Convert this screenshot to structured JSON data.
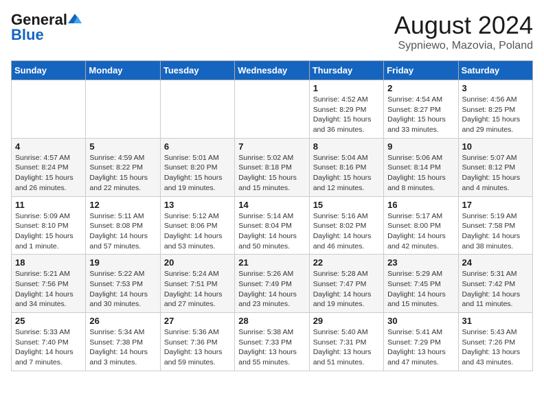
{
  "header": {
    "logo_line1": "General",
    "logo_line2": "Blue",
    "month_title": "August 2024",
    "subtitle": "Sypniewo, Mazovia, Poland"
  },
  "days_of_week": [
    "Sunday",
    "Monday",
    "Tuesday",
    "Wednesday",
    "Thursday",
    "Friday",
    "Saturday"
  ],
  "weeks": [
    [
      {
        "num": "",
        "info": ""
      },
      {
        "num": "",
        "info": ""
      },
      {
        "num": "",
        "info": ""
      },
      {
        "num": "",
        "info": ""
      },
      {
        "num": "1",
        "info": "Sunrise: 4:52 AM\nSunset: 8:29 PM\nDaylight: 15 hours\nand 36 minutes."
      },
      {
        "num": "2",
        "info": "Sunrise: 4:54 AM\nSunset: 8:27 PM\nDaylight: 15 hours\nand 33 minutes."
      },
      {
        "num": "3",
        "info": "Sunrise: 4:56 AM\nSunset: 8:25 PM\nDaylight: 15 hours\nand 29 minutes."
      }
    ],
    [
      {
        "num": "4",
        "info": "Sunrise: 4:57 AM\nSunset: 8:24 PM\nDaylight: 15 hours\nand 26 minutes."
      },
      {
        "num": "5",
        "info": "Sunrise: 4:59 AM\nSunset: 8:22 PM\nDaylight: 15 hours\nand 22 minutes."
      },
      {
        "num": "6",
        "info": "Sunrise: 5:01 AM\nSunset: 8:20 PM\nDaylight: 15 hours\nand 19 minutes."
      },
      {
        "num": "7",
        "info": "Sunrise: 5:02 AM\nSunset: 8:18 PM\nDaylight: 15 hours\nand 15 minutes."
      },
      {
        "num": "8",
        "info": "Sunrise: 5:04 AM\nSunset: 8:16 PM\nDaylight: 15 hours\nand 12 minutes."
      },
      {
        "num": "9",
        "info": "Sunrise: 5:06 AM\nSunset: 8:14 PM\nDaylight: 15 hours\nand 8 minutes."
      },
      {
        "num": "10",
        "info": "Sunrise: 5:07 AM\nSunset: 8:12 PM\nDaylight: 15 hours\nand 4 minutes."
      }
    ],
    [
      {
        "num": "11",
        "info": "Sunrise: 5:09 AM\nSunset: 8:10 PM\nDaylight: 15 hours\nand 1 minute."
      },
      {
        "num": "12",
        "info": "Sunrise: 5:11 AM\nSunset: 8:08 PM\nDaylight: 14 hours\nand 57 minutes."
      },
      {
        "num": "13",
        "info": "Sunrise: 5:12 AM\nSunset: 8:06 PM\nDaylight: 14 hours\nand 53 minutes."
      },
      {
        "num": "14",
        "info": "Sunrise: 5:14 AM\nSunset: 8:04 PM\nDaylight: 14 hours\nand 50 minutes."
      },
      {
        "num": "15",
        "info": "Sunrise: 5:16 AM\nSunset: 8:02 PM\nDaylight: 14 hours\nand 46 minutes."
      },
      {
        "num": "16",
        "info": "Sunrise: 5:17 AM\nSunset: 8:00 PM\nDaylight: 14 hours\nand 42 minutes."
      },
      {
        "num": "17",
        "info": "Sunrise: 5:19 AM\nSunset: 7:58 PM\nDaylight: 14 hours\nand 38 minutes."
      }
    ],
    [
      {
        "num": "18",
        "info": "Sunrise: 5:21 AM\nSunset: 7:56 PM\nDaylight: 14 hours\nand 34 minutes."
      },
      {
        "num": "19",
        "info": "Sunrise: 5:22 AM\nSunset: 7:53 PM\nDaylight: 14 hours\nand 30 minutes."
      },
      {
        "num": "20",
        "info": "Sunrise: 5:24 AM\nSunset: 7:51 PM\nDaylight: 14 hours\nand 27 minutes."
      },
      {
        "num": "21",
        "info": "Sunrise: 5:26 AM\nSunset: 7:49 PM\nDaylight: 14 hours\nand 23 minutes."
      },
      {
        "num": "22",
        "info": "Sunrise: 5:28 AM\nSunset: 7:47 PM\nDaylight: 14 hours\nand 19 minutes."
      },
      {
        "num": "23",
        "info": "Sunrise: 5:29 AM\nSunset: 7:45 PM\nDaylight: 14 hours\nand 15 minutes."
      },
      {
        "num": "24",
        "info": "Sunrise: 5:31 AM\nSunset: 7:42 PM\nDaylight: 14 hours\nand 11 minutes."
      }
    ],
    [
      {
        "num": "25",
        "info": "Sunrise: 5:33 AM\nSunset: 7:40 PM\nDaylight: 14 hours\nand 7 minutes."
      },
      {
        "num": "26",
        "info": "Sunrise: 5:34 AM\nSunset: 7:38 PM\nDaylight: 14 hours\nand 3 minutes."
      },
      {
        "num": "27",
        "info": "Sunrise: 5:36 AM\nSunset: 7:36 PM\nDaylight: 13 hours\nand 59 minutes."
      },
      {
        "num": "28",
        "info": "Sunrise: 5:38 AM\nSunset: 7:33 PM\nDaylight: 13 hours\nand 55 minutes."
      },
      {
        "num": "29",
        "info": "Sunrise: 5:40 AM\nSunset: 7:31 PM\nDaylight: 13 hours\nand 51 minutes."
      },
      {
        "num": "30",
        "info": "Sunrise: 5:41 AM\nSunset: 7:29 PM\nDaylight: 13 hours\nand 47 minutes."
      },
      {
        "num": "31",
        "info": "Sunrise: 5:43 AM\nSunset: 7:26 PM\nDaylight: 13 hours\nand 43 minutes."
      }
    ]
  ]
}
